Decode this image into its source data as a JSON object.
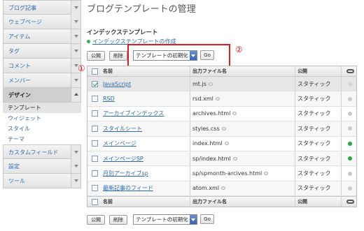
{
  "sidebar": {
    "items": [
      {
        "label": "ブログ記事"
      },
      {
        "label": "ウェブページ"
      },
      {
        "label": "アイテム"
      },
      {
        "label": "タグ"
      },
      {
        "label": "コメント"
      },
      {
        "label": "メンバー"
      },
      {
        "label": "デザイン"
      }
    ],
    "sub_items": [
      {
        "label": "テンプレート"
      },
      {
        "label": "ウィジェット"
      },
      {
        "label": "スタイル"
      },
      {
        "label": "テーマ"
      }
    ],
    "items_after": [
      {
        "label": "カスタムフィールド"
      },
      {
        "label": "設定"
      },
      {
        "label": "ツール"
      }
    ]
  },
  "page": {
    "title": "ブログテンプレートの管理",
    "section_title": "インデックステンプレート",
    "create_link": "インデックステンプレートの作成"
  },
  "toolbar": {
    "publish_label": "公開",
    "delete_label": "削除",
    "action_select": "テンプレートの初期化",
    "go_label": "Go"
  },
  "annotations": {
    "marker_1": "①",
    "marker_2": "②"
  },
  "table": {
    "headers": {
      "name": "名前",
      "output_file": "出力ファイル名",
      "publish": "公開"
    },
    "rows": [
      {
        "name": "JavaScript",
        "file": "mt.js",
        "publish": "スタティック",
        "checked": true,
        "status": "diamond"
      },
      {
        "name": "RSD",
        "file": "rsd.xml",
        "publish": "スタティック",
        "checked": false,
        "status": "gray"
      },
      {
        "name": "アーカイブインデックス",
        "file": "archives.html",
        "publish": "スタティック",
        "checked": false,
        "status": "gray"
      },
      {
        "name": "スタイルシート",
        "file": "styles.css",
        "publish": "スタティック",
        "checked": false,
        "status": "gray"
      },
      {
        "name": "メインページ",
        "file": "index.html",
        "publish": "スタティック",
        "checked": false,
        "status": "green"
      },
      {
        "name": "メインページSP",
        "file": "sp/index.html",
        "publish": "スタティック",
        "checked": false,
        "status": "green"
      },
      {
        "name": "月別アーカイブsp",
        "file": "sp/spmonth-arcives.html",
        "publish": "スタティック",
        "checked": false,
        "status": "gray"
      },
      {
        "name": "最新記事のフィード",
        "file": "atom.xml",
        "publish": "スタティック",
        "checked": false,
        "status": "gray"
      }
    ]
  },
  "colors": {
    "accent_red": "#e0191d",
    "link": "#2a6ab0",
    "status_green": "#22aa3a"
  }
}
